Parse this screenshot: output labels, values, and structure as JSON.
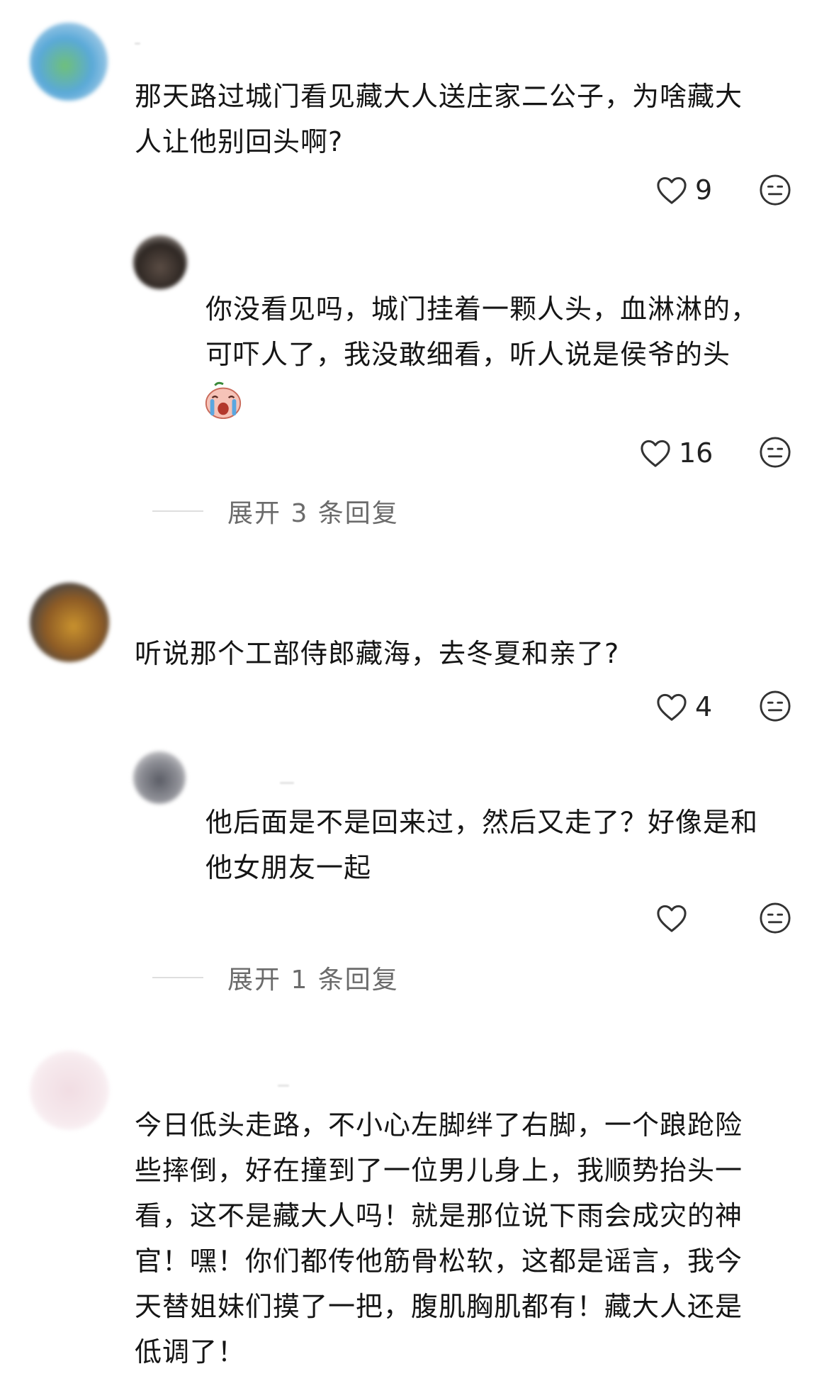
{
  "comments": [
    {
      "text_lines": [
        "那天路过城门看见藏大人送庄家二公子，为啥藏大",
        "人让他别回头啊?"
      ],
      "likes": "9",
      "reply": {
        "text_lines": [
          "你没看见吗，城门挂着一颗人头，血淋淋的，",
          "可吓人了，我没敢细看，听人说是侯爷的头"
        ],
        "emoji_icon": "crying-face-emoji",
        "likes": "16"
      },
      "expand_label": "展开 3 条回复"
    },
    {
      "text_lines": [
        "听说那个工部侍郎藏海，去冬夏和亲了?"
      ],
      "likes": "4",
      "reply": {
        "text_lines": [
          "他后面是不是回来过，然后又走了？好像是和",
          "他女朋友一起"
        ],
        "likes": ""
      },
      "expand_label": "展开 1 条回复"
    },
    {
      "text_lines": [
        "今日低头走路，不小心左脚绊了右脚，一个踉跄险",
        "些摔倒，好在撞到了一位男儿身上，我顺势抬头一",
        "看，这不是藏大人吗！就是那位说下雨会成灾的神",
        "官！嘿！你们都传他筋骨松软，这都是谣言，我今",
        "天替姐妹们摸了一把，腹肌胸肌都有！藏大人还是",
        "低调了！"
      ]
    }
  ],
  "icons": {
    "like": "heart-outline-icon",
    "reaction": "neutral-face-icon"
  },
  "colors": {
    "text": "#151515",
    "muted": "#6b6b6b",
    "icon": "#333333",
    "divider": "#dedede"
  }
}
